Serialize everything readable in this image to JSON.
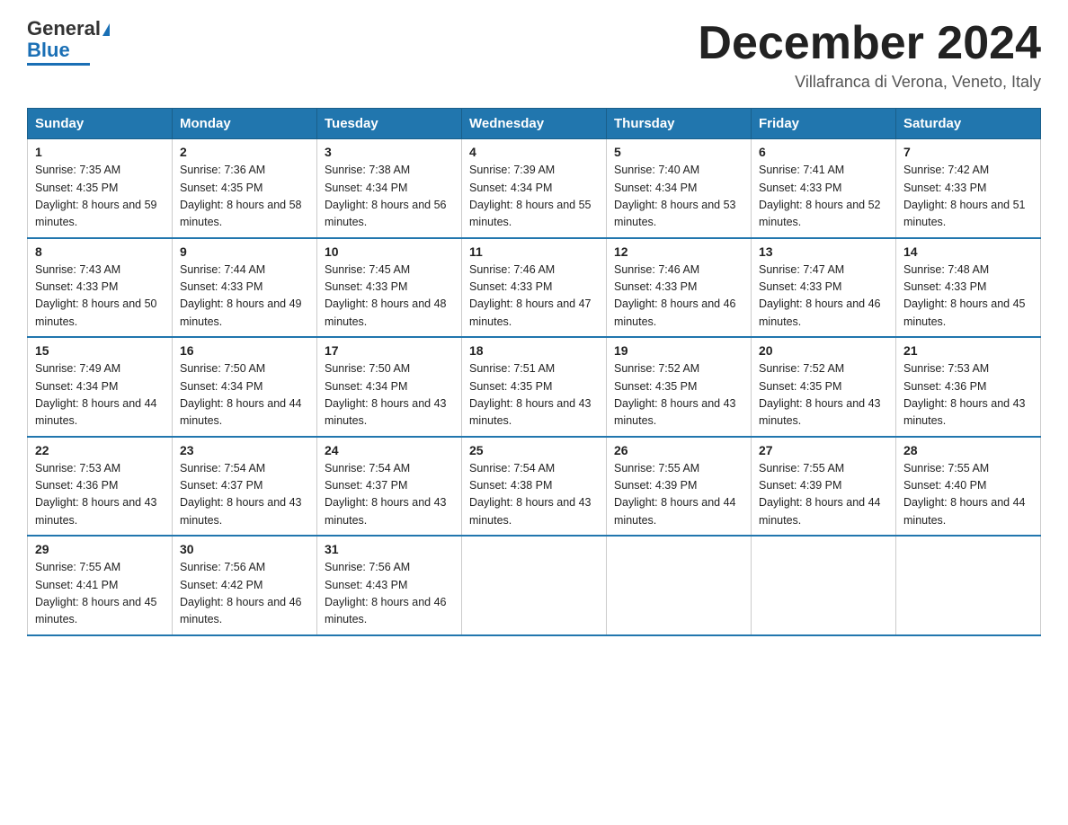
{
  "header": {
    "logo_general": "General",
    "logo_blue": "Blue",
    "month_title": "December 2024",
    "location": "Villafranca di Verona, Veneto, Italy"
  },
  "days_of_week": [
    "Sunday",
    "Monday",
    "Tuesday",
    "Wednesday",
    "Thursday",
    "Friday",
    "Saturday"
  ],
  "weeks": [
    [
      {
        "date": "1",
        "sunrise": "7:35 AM",
        "sunset": "4:35 PM",
        "daylight": "8 hours and 59 minutes."
      },
      {
        "date": "2",
        "sunrise": "7:36 AM",
        "sunset": "4:35 PM",
        "daylight": "8 hours and 58 minutes."
      },
      {
        "date": "3",
        "sunrise": "7:38 AM",
        "sunset": "4:34 PM",
        "daylight": "8 hours and 56 minutes."
      },
      {
        "date": "4",
        "sunrise": "7:39 AM",
        "sunset": "4:34 PM",
        "daylight": "8 hours and 55 minutes."
      },
      {
        "date": "5",
        "sunrise": "7:40 AM",
        "sunset": "4:34 PM",
        "daylight": "8 hours and 53 minutes."
      },
      {
        "date": "6",
        "sunrise": "7:41 AM",
        "sunset": "4:33 PM",
        "daylight": "8 hours and 52 minutes."
      },
      {
        "date": "7",
        "sunrise": "7:42 AM",
        "sunset": "4:33 PM",
        "daylight": "8 hours and 51 minutes."
      }
    ],
    [
      {
        "date": "8",
        "sunrise": "7:43 AM",
        "sunset": "4:33 PM",
        "daylight": "8 hours and 50 minutes."
      },
      {
        "date": "9",
        "sunrise": "7:44 AM",
        "sunset": "4:33 PM",
        "daylight": "8 hours and 49 minutes."
      },
      {
        "date": "10",
        "sunrise": "7:45 AM",
        "sunset": "4:33 PM",
        "daylight": "8 hours and 48 minutes."
      },
      {
        "date": "11",
        "sunrise": "7:46 AM",
        "sunset": "4:33 PM",
        "daylight": "8 hours and 47 minutes."
      },
      {
        "date": "12",
        "sunrise": "7:46 AM",
        "sunset": "4:33 PM",
        "daylight": "8 hours and 46 minutes."
      },
      {
        "date": "13",
        "sunrise": "7:47 AM",
        "sunset": "4:33 PM",
        "daylight": "8 hours and 46 minutes."
      },
      {
        "date": "14",
        "sunrise": "7:48 AM",
        "sunset": "4:33 PM",
        "daylight": "8 hours and 45 minutes."
      }
    ],
    [
      {
        "date": "15",
        "sunrise": "7:49 AM",
        "sunset": "4:34 PM",
        "daylight": "8 hours and 44 minutes."
      },
      {
        "date": "16",
        "sunrise": "7:50 AM",
        "sunset": "4:34 PM",
        "daylight": "8 hours and 44 minutes."
      },
      {
        "date": "17",
        "sunrise": "7:50 AM",
        "sunset": "4:34 PM",
        "daylight": "8 hours and 43 minutes."
      },
      {
        "date": "18",
        "sunrise": "7:51 AM",
        "sunset": "4:35 PM",
        "daylight": "8 hours and 43 minutes."
      },
      {
        "date": "19",
        "sunrise": "7:52 AM",
        "sunset": "4:35 PM",
        "daylight": "8 hours and 43 minutes."
      },
      {
        "date": "20",
        "sunrise": "7:52 AM",
        "sunset": "4:35 PM",
        "daylight": "8 hours and 43 minutes."
      },
      {
        "date": "21",
        "sunrise": "7:53 AM",
        "sunset": "4:36 PM",
        "daylight": "8 hours and 43 minutes."
      }
    ],
    [
      {
        "date": "22",
        "sunrise": "7:53 AM",
        "sunset": "4:36 PM",
        "daylight": "8 hours and 43 minutes."
      },
      {
        "date": "23",
        "sunrise": "7:54 AM",
        "sunset": "4:37 PM",
        "daylight": "8 hours and 43 minutes."
      },
      {
        "date": "24",
        "sunrise": "7:54 AM",
        "sunset": "4:37 PM",
        "daylight": "8 hours and 43 minutes."
      },
      {
        "date": "25",
        "sunrise": "7:54 AM",
        "sunset": "4:38 PM",
        "daylight": "8 hours and 43 minutes."
      },
      {
        "date": "26",
        "sunrise": "7:55 AM",
        "sunset": "4:39 PM",
        "daylight": "8 hours and 44 minutes."
      },
      {
        "date": "27",
        "sunrise": "7:55 AM",
        "sunset": "4:39 PM",
        "daylight": "8 hours and 44 minutes."
      },
      {
        "date": "28",
        "sunrise": "7:55 AM",
        "sunset": "4:40 PM",
        "daylight": "8 hours and 44 minutes."
      }
    ],
    [
      {
        "date": "29",
        "sunrise": "7:55 AM",
        "sunset": "4:41 PM",
        "daylight": "8 hours and 45 minutes."
      },
      {
        "date": "30",
        "sunrise": "7:56 AM",
        "sunset": "4:42 PM",
        "daylight": "8 hours and 46 minutes."
      },
      {
        "date": "31",
        "sunrise": "7:56 AM",
        "sunset": "4:43 PM",
        "daylight": "8 hours and 46 minutes."
      },
      null,
      null,
      null,
      null
    ]
  ]
}
